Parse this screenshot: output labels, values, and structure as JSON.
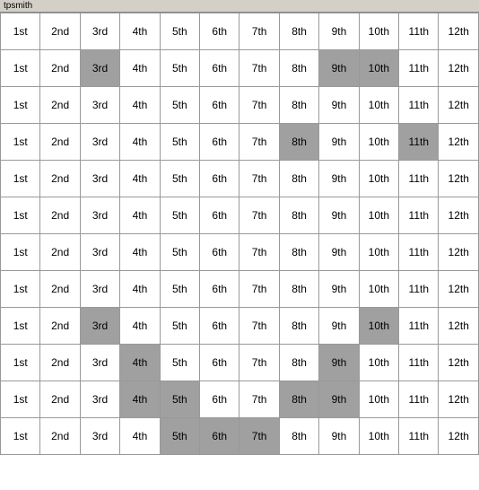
{
  "title": "tpsmith",
  "cols": [
    "1st",
    "2nd",
    "3rd",
    "4th",
    "5th",
    "6th",
    "7th",
    "8th",
    "9th",
    "10th",
    "11th",
    "12th"
  ],
  "rows": [
    {
      "cells": [
        {
          "text": "1st",
          "hl": false
        },
        {
          "text": "2nd",
          "hl": false
        },
        {
          "text": "3rd",
          "hl": false
        },
        {
          "text": "4th",
          "hl": false
        },
        {
          "text": "5th",
          "hl": false
        },
        {
          "text": "6th",
          "hl": false
        },
        {
          "text": "7th",
          "hl": false
        },
        {
          "text": "8th",
          "hl": false
        },
        {
          "text": "9th",
          "hl": false
        },
        {
          "text": "10th",
          "hl": false
        },
        {
          "text": "11th",
          "hl": false
        },
        {
          "text": "12th",
          "hl": false
        }
      ]
    },
    {
      "cells": [
        {
          "text": "1st",
          "hl": false
        },
        {
          "text": "2nd",
          "hl": false
        },
        {
          "text": "3rd",
          "hl": true
        },
        {
          "text": "4th",
          "hl": false
        },
        {
          "text": "5th",
          "hl": false
        },
        {
          "text": "6th",
          "hl": false
        },
        {
          "text": "7th",
          "hl": false
        },
        {
          "text": "8th",
          "hl": false
        },
        {
          "text": "9th",
          "hl": true
        },
        {
          "text": "10th",
          "hl": true
        },
        {
          "text": "11th",
          "hl": false
        },
        {
          "text": "12th",
          "hl": false
        }
      ]
    },
    {
      "cells": [
        {
          "text": "1st",
          "hl": false
        },
        {
          "text": "2nd",
          "hl": false
        },
        {
          "text": "3rd",
          "hl": false
        },
        {
          "text": "4th",
          "hl": false
        },
        {
          "text": "5th",
          "hl": false
        },
        {
          "text": "6th",
          "hl": false
        },
        {
          "text": "7th",
          "hl": false
        },
        {
          "text": "8th",
          "hl": false
        },
        {
          "text": "9th",
          "hl": false
        },
        {
          "text": "10th",
          "hl": false
        },
        {
          "text": "11th",
          "hl": false
        },
        {
          "text": "12th",
          "hl": false
        }
      ]
    },
    {
      "cells": [
        {
          "text": "1st",
          "hl": false
        },
        {
          "text": "2nd",
          "hl": false
        },
        {
          "text": "3rd",
          "hl": false
        },
        {
          "text": "4th",
          "hl": false
        },
        {
          "text": "5th",
          "hl": false
        },
        {
          "text": "6th",
          "hl": false
        },
        {
          "text": "7th",
          "hl": false
        },
        {
          "text": "8th",
          "hl": true
        },
        {
          "text": "9th",
          "hl": false
        },
        {
          "text": "10th",
          "hl": false
        },
        {
          "text": "11th",
          "hl": true
        },
        {
          "text": "12th",
          "hl": false
        }
      ]
    },
    {
      "cells": [
        {
          "text": "1st",
          "hl": false
        },
        {
          "text": "2nd",
          "hl": false
        },
        {
          "text": "3rd",
          "hl": false
        },
        {
          "text": "4th",
          "hl": false
        },
        {
          "text": "5th",
          "hl": false
        },
        {
          "text": "6th",
          "hl": false
        },
        {
          "text": "7th",
          "hl": false
        },
        {
          "text": "8th",
          "hl": false
        },
        {
          "text": "9th",
          "hl": false
        },
        {
          "text": "10th",
          "hl": false
        },
        {
          "text": "11th",
          "hl": false
        },
        {
          "text": "12th",
          "hl": false
        }
      ]
    },
    {
      "cells": [
        {
          "text": "1st",
          "hl": false
        },
        {
          "text": "2nd",
          "hl": false
        },
        {
          "text": "3rd",
          "hl": false
        },
        {
          "text": "4th",
          "hl": false
        },
        {
          "text": "5th",
          "hl": false
        },
        {
          "text": "6th",
          "hl": false
        },
        {
          "text": "7th",
          "hl": false
        },
        {
          "text": "8th",
          "hl": false
        },
        {
          "text": "9th",
          "hl": false
        },
        {
          "text": "10th",
          "hl": false
        },
        {
          "text": "11th",
          "hl": false
        },
        {
          "text": "12th",
          "hl": false
        }
      ]
    },
    {
      "cells": [
        {
          "text": "1st",
          "hl": false
        },
        {
          "text": "2nd",
          "hl": false
        },
        {
          "text": "3rd",
          "hl": false
        },
        {
          "text": "4th",
          "hl": false
        },
        {
          "text": "5th",
          "hl": false
        },
        {
          "text": "6th",
          "hl": false
        },
        {
          "text": "7th",
          "hl": false
        },
        {
          "text": "8th",
          "hl": false
        },
        {
          "text": "9th",
          "hl": false
        },
        {
          "text": "10th",
          "hl": false
        },
        {
          "text": "11th",
          "hl": false
        },
        {
          "text": "12th",
          "hl": false
        }
      ]
    },
    {
      "cells": [
        {
          "text": "1st",
          "hl": false
        },
        {
          "text": "2nd",
          "hl": false
        },
        {
          "text": "3rd",
          "hl": false
        },
        {
          "text": "4th",
          "hl": false
        },
        {
          "text": "5th",
          "hl": false
        },
        {
          "text": "6th",
          "hl": false
        },
        {
          "text": "7th",
          "hl": false
        },
        {
          "text": "8th",
          "hl": false
        },
        {
          "text": "9th",
          "hl": false
        },
        {
          "text": "10th",
          "hl": false
        },
        {
          "text": "11th",
          "hl": false
        },
        {
          "text": "12th",
          "hl": false
        }
      ]
    },
    {
      "cells": [
        {
          "text": "1st",
          "hl": false
        },
        {
          "text": "2nd",
          "hl": false
        },
        {
          "text": "3rd",
          "hl": true
        },
        {
          "text": "4th",
          "hl": false
        },
        {
          "text": "5th",
          "hl": false
        },
        {
          "text": "6th",
          "hl": false
        },
        {
          "text": "7th",
          "hl": false
        },
        {
          "text": "8th",
          "hl": false
        },
        {
          "text": "9th",
          "hl": false
        },
        {
          "text": "10th",
          "hl": true
        },
        {
          "text": "11th",
          "hl": false
        },
        {
          "text": "12th",
          "hl": false
        }
      ]
    },
    {
      "cells": [
        {
          "text": "1st",
          "hl": false
        },
        {
          "text": "2nd",
          "hl": false
        },
        {
          "text": "3rd",
          "hl": false
        },
        {
          "text": "4th",
          "hl": true
        },
        {
          "text": "5th",
          "hl": false
        },
        {
          "text": "6th",
          "hl": false
        },
        {
          "text": "7th",
          "hl": false
        },
        {
          "text": "8th",
          "hl": false
        },
        {
          "text": "9th",
          "hl": true
        },
        {
          "text": "10th",
          "hl": false
        },
        {
          "text": "11th",
          "hl": false
        },
        {
          "text": "12th",
          "hl": false
        }
      ]
    },
    {
      "cells": [
        {
          "text": "1st",
          "hl": false
        },
        {
          "text": "2nd",
          "hl": false
        },
        {
          "text": "3rd",
          "hl": false
        },
        {
          "text": "4th",
          "hl": true
        },
        {
          "text": "5th",
          "hl": true
        },
        {
          "text": "6th",
          "hl": false
        },
        {
          "text": "7th",
          "hl": false
        },
        {
          "text": "8th",
          "hl": true
        },
        {
          "text": "9th",
          "hl": true
        },
        {
          "text": "10th",
          "hl": false
        },
        {
          "text": "11th",
          "hl": false
        },
        {
          "text": "12th",
          "hl": false
        }
      ]
    },
    {
      "cells": [
        {
          "text": "1st",
          "hl": false
        },
        {
          "text": "2nd",
          "hl": false
        },
        {
          "text": "3rd",
          "hl": false
        },
        {
          "text": "4th",
          "hl": false
        },
        {
          "text": "5th",
          "hl": true
        },
        {
          "text": "6th",
          "hl": true
        },
        {
          "text": "7th",
          "hl": true
        },
        {
          "text": "8th",
          "hl": false
        },
        {
          "text": "9th",
          "hl": false
        },
        {
          "text": "10th",
          "hl": false
        },
        {
          "text": "11th",
          "hl": false
        },
        {
          "text": "12th",
          "hl": false
        }
      ]
    }
  ]
}
